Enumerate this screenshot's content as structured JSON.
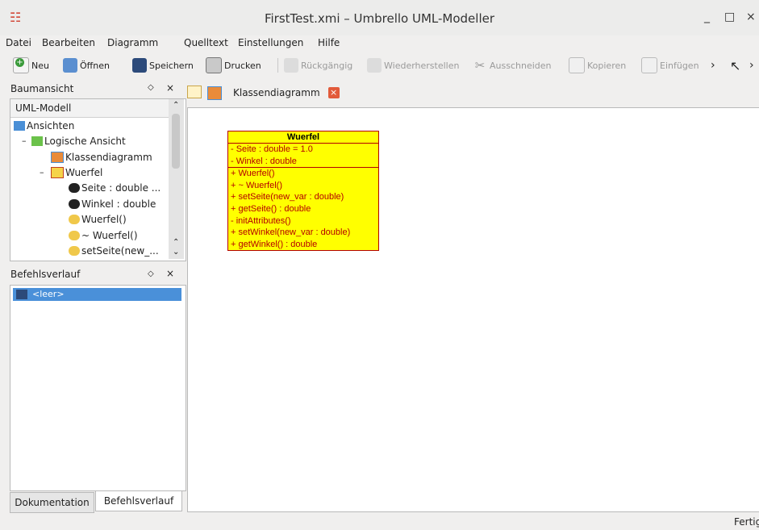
{
  "window": {
    "title": "FirstTest.xmi – Umbrello UML-Modeller",
    "minimize": "_",
    "maximize": "□",
    "close": "×"
  },
  "menu": [
    "Datei",
    "Bearbeiten",
    "Diagramm",
    "Quelltext",
    "Einstellungen",
    "Hilfe"
  ],
  "toolbar": {
    "new": "Neu",
    "open": "Öffnen",
    "save": "Speichern",
    "print": "Drucken",
    "undo": "Rückgängig",
    "redo": "Wiederherstellen",
    "cut": "Ausschneiden",
    "copy": "Kopieren",
    "paste": "Einfügen",
    "more": "›",
    "more2": "›"
  },
  "tree_panel": {
    "title": "Baumansicht",
    "header": "UML-Modell",
    "items": [
      "Ansichten",
      "Logische Ansicht",
      "Klassendiagramm",
      "Wuerfel",
      "Seite : double ...",
      "Winkel : double",
      "Wuerfel()",
      "~ Wuerfel()",
      "setSeite(new_..."
    ],
    "expanders": [
      "–",
      "–"
    ]
  },
  "history_panel": {
    "title": "Befehlsverlauf",
    "items": [
      "<leer>"
    ]
  },
  "bottom_tabs": [
    "Dokumentation",
    "Befehlsverlauf"
  ],
  "diagram_tab": {
    "label": "Klassendiagramm"
  },
  "uml_class": {
    "name": "Wuerfel",
    "attributes": [
      "- Seite : double = 1.0",
      "- Winkel : double"
    ],
    "operations": [
      "+ Wuerfel()",
      "+ ~ Wuerfel()",
      "+ setSeite(new_var : double)",
      "+ getSeite() : double",
      "- initAttributes()",
      "+ setWinkel(new_var : double)",
      "+ getWinkel() : double"
    ]
  },
  "status": {
    "text": "Fertig"
  },
  "colors": {
    "class_fill": "#ffff00",
    "class_border": "#b40000",
    "selection": "#4a90d9"
  }
}
